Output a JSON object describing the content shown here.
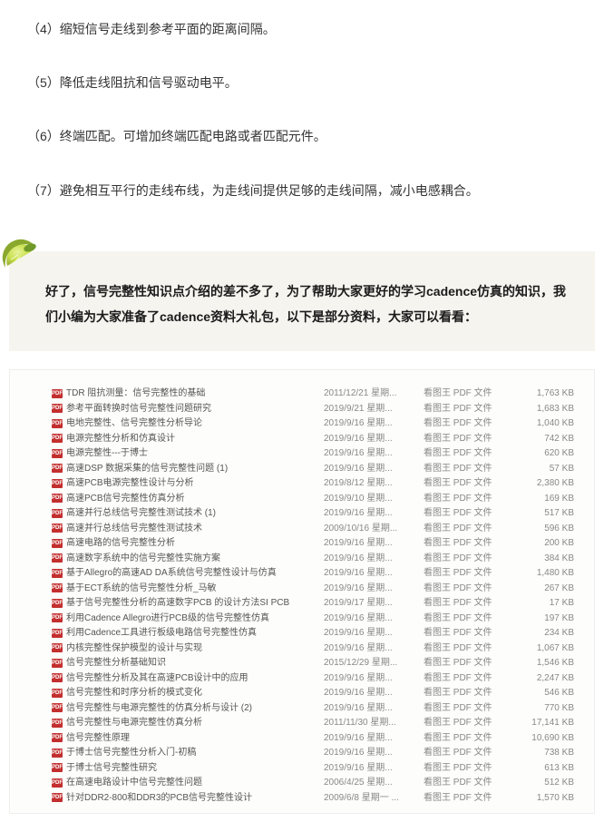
{
  "paragraphs": {
    "p4": "（4）缩短信号走线到参考平面的距离间隔。",
    "p5": "（5）降低走线阻抗和信号驱动电平。",
    "p6": "（6）终端匹配。可增加终端匹配电路或者匹配元件。",
    "p7": "（7）避免相互平行的走线布线，为走线间提供足够的走线间隔，减小电感耦合。"
  },
  "highlight": {
    "text": "好了，信号完整性知识点介绍的差不多了，为了帮助大家更好的学习cadence仿真的知识，我们小编为大家准备了cadence资料大礼包，以下是部分资料，大家可以看看："
  },
  "icons": {
    "pdf_label": "PDF"
  },
  "file_table": {
    "type_label": "看图王 PDF 文件",
    "rows": [
      {
        "name": "TDR 阻抗测量：信号完整性的基础",
        "date": "2011/12/21 星期...",
        "size": "1,763 KB"
      },
      {
        "name": "参考平面转换时信号完整性问题研究",
        "date": "2019/9/21 星期...",
        "size": "1,683 KB"
      },
      {
        "name": "电地完整性、信号完整性分析导论",
        "date": "2019/9/16 星期...",
        "size": "1,040 KB"
      },
      {
        "name": "电源完整性分析和仿真设计",
        "date": "2019/9/16 星期...",
        "size": "742 KB"
      },
      {
        "name": "电源完整性---于博士",
        "date": "2019/9/16 星期...",
        "size": "620 KB"
      },
      {
        "name": "高速DSP 数据采集的信号完整性问题 (1)",
        "date": "2019/9/16 星期...",
        "size": "57 KB"
      },
      {
        "name": "高速PCB电源完整性设计与分析",
        "date": "2019/8/12 星期...",
        "size": "2,380 KB"
      },
      {
        "name": "高速PCB信号完整性仿真分析",
        "date": "2019/9/10 星期...",
        "size": "169 KB"
      },
      {
        "name": "高速并行总线信号完整性测试技术 (1)",
        "date": "2019/9/16 星期...",
        "size": "517 KB"
      },
      {
        "name": "高速并行总线信号完整性测试技术",
        "date": "2009/10/16 星期...",
        "size": "596 KB"
      },
      {
        "name": "高速电路的信号完整性分析",
        "date": "2019/9/16 星期...",
        "size": "200 KB"
      },
      {
        "name": "高速数字系统中的信号完整性实施方案",
        "date": "2019/9/16 星期...",
        "size": "384 KB"
      },
      {
        "name": "基于Allegro的高速AD DA系统信号完整性设计与仿真",
        "date": "2019/9/16 星期...",
        "size": "1,480 KB"
      },
      {
        "name": "基于ECT系统的信号完整性分析_马敏",
        "date": "2019/9/16 星期...",
        "size": "267 KB"
      },
      {
        "name": "基于信号完整性分析的高速数字PCB 的设计方法SI PCB",
        "date": "2019/9/17 星期...",
        "size": "17 KB"
      },
      {
        "name": "利用Cadence Allegro进行PCB级的信号完整性仿真",
        "date": "2019/9/16 星期...",
        "size": "197 KB"
      },
      {
        "name": "利用Cadence工具进行板级电路信号完整性仿真",
        "date": "2019/9/16 星期...",
        "size": "234 KB"
      },
      {
        "name": "内核完整性保护模型的设计与实现",
        "date": "2019/9/16 星期...",
        "size": "1,067 KB"
      },
      {
        "name": "信号完整性分析基础知识",
        "date": "2015/12/29 星期...",
        "size": "1,546 KB"
      },
      {
        "name": "信号完整性分析及其在高速PCB设计中的应用",
        "date": "2019/9/16 星期...",
        "size": "2,247 KB"
      },
      {
        "name": "信号完整性和时序分析的模式变化",
        "date": "2019/9/16 星期...",
        "size": "546 KB"
      },
      {
        "name": "信号完整性与电源完整性的仿真分析与设计 (2)",
        "date": "2019/9/16 星期...",
        "size": "770 KB"
      },
      {
        "name": "信号完整性与电源完整性仿真分析",
        "date": "2011/11/30 星期...",
        "size": "17,141 KB"
      },
      {
        "name": "信号完整性原理",
        "date": "2019/9/16 星期...",
        "size": "10,690 KB"
      },
      {
        "name": "于博士信号完整性分析入门-初稿",
        "date": "2019/9/16 星期...",
        "size": "738 KB"
      },
      {
        "name": "于博士信号完整性研究",
        "date": "2019/9/16 星期...",
        "size": "613 KB"
      },
      {
        "name": "在高速电路设计中信号完整性问题",
        "date": "2006/4/25 星期...",
        "size": "512 KB"
      },
      {
        "name": "针对DDR2-800和DDR3的PCB信号完整性设计",
        "date": "2009/6/8 星期一 ...",
        "size": "1,570 KB"
      }
    ]
  }
}
